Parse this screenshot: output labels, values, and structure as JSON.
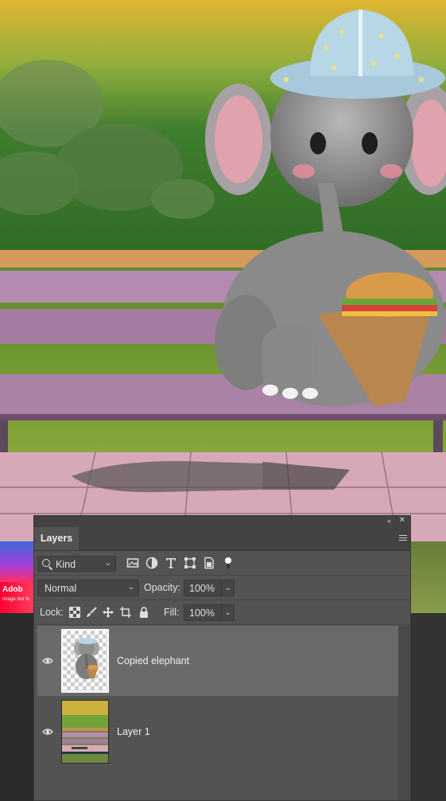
{
  "canvas": {
    "watermark_title": "Adob",
    "watermark_sub": "Image Not fo"
  },
  "panel": {
    "collapse_glyph": "«",
    "close_glyph": "✕",
    "tab": "Layers",
    "filter": {
      "kind_label": "Kind"
    },
    "filter_icons": [
      "image-filter-icon",
      "adjustment-filter-icon",
      "type-filter-icon",
      "shape-filter-icon",
      "smart-object-filter-icon",
      "filter-toggle-icon"
    ],
    "blend_mode": "Normal",
    "opacity_label": "Opacity:",
    "opacity_value": "100%",
    "lock_label": "Lock:",
    "lock_icons": [
      "lock-transparent-pixels-icon",
      "lock-image-pixels-icon",
      "lock-position-icon",
      "lock-artboard-icon",
      "lock-all-icon"
    ],
    "fill_label": "Fill:",
    "fill_value": "100%",
    "layers": [
      {
        "name": "Copied elephant",
        "selected": true,
        "visible": true
      },
      {
        "name": "Layer 1",
        "selected": false,
        "visible": true
      }
    ]
  }
}
